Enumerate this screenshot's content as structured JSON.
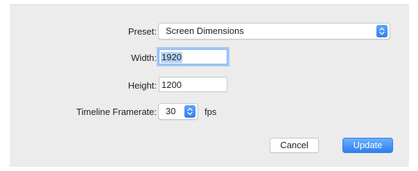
{
  "form": {
    "preset": {
      "label": "Preset:",
      "value": "Screen Dimensions",
      "icon": "stepper-arrows-icon"
    },
    "width": {
      "label": "Width:",
      "value": "1920"
    },
    "height": {
      "label": "Height:",
      "value": "1200"
    },
    "framerate": {
      "label": "Timeline Framerate:",
      "value": "30",
      "unit": "fps",
      "icon": "stepper-arrows-icon"
    }
  },
  "buttons": {
    "cancel_label": "Cancel",
    "update_label": "Update"
  },
  "colors": {
    "accent": "#3b8ef5",
    "dialog_bg": "#ececec",
    "selection": "#b5d4fa"
  }
}
